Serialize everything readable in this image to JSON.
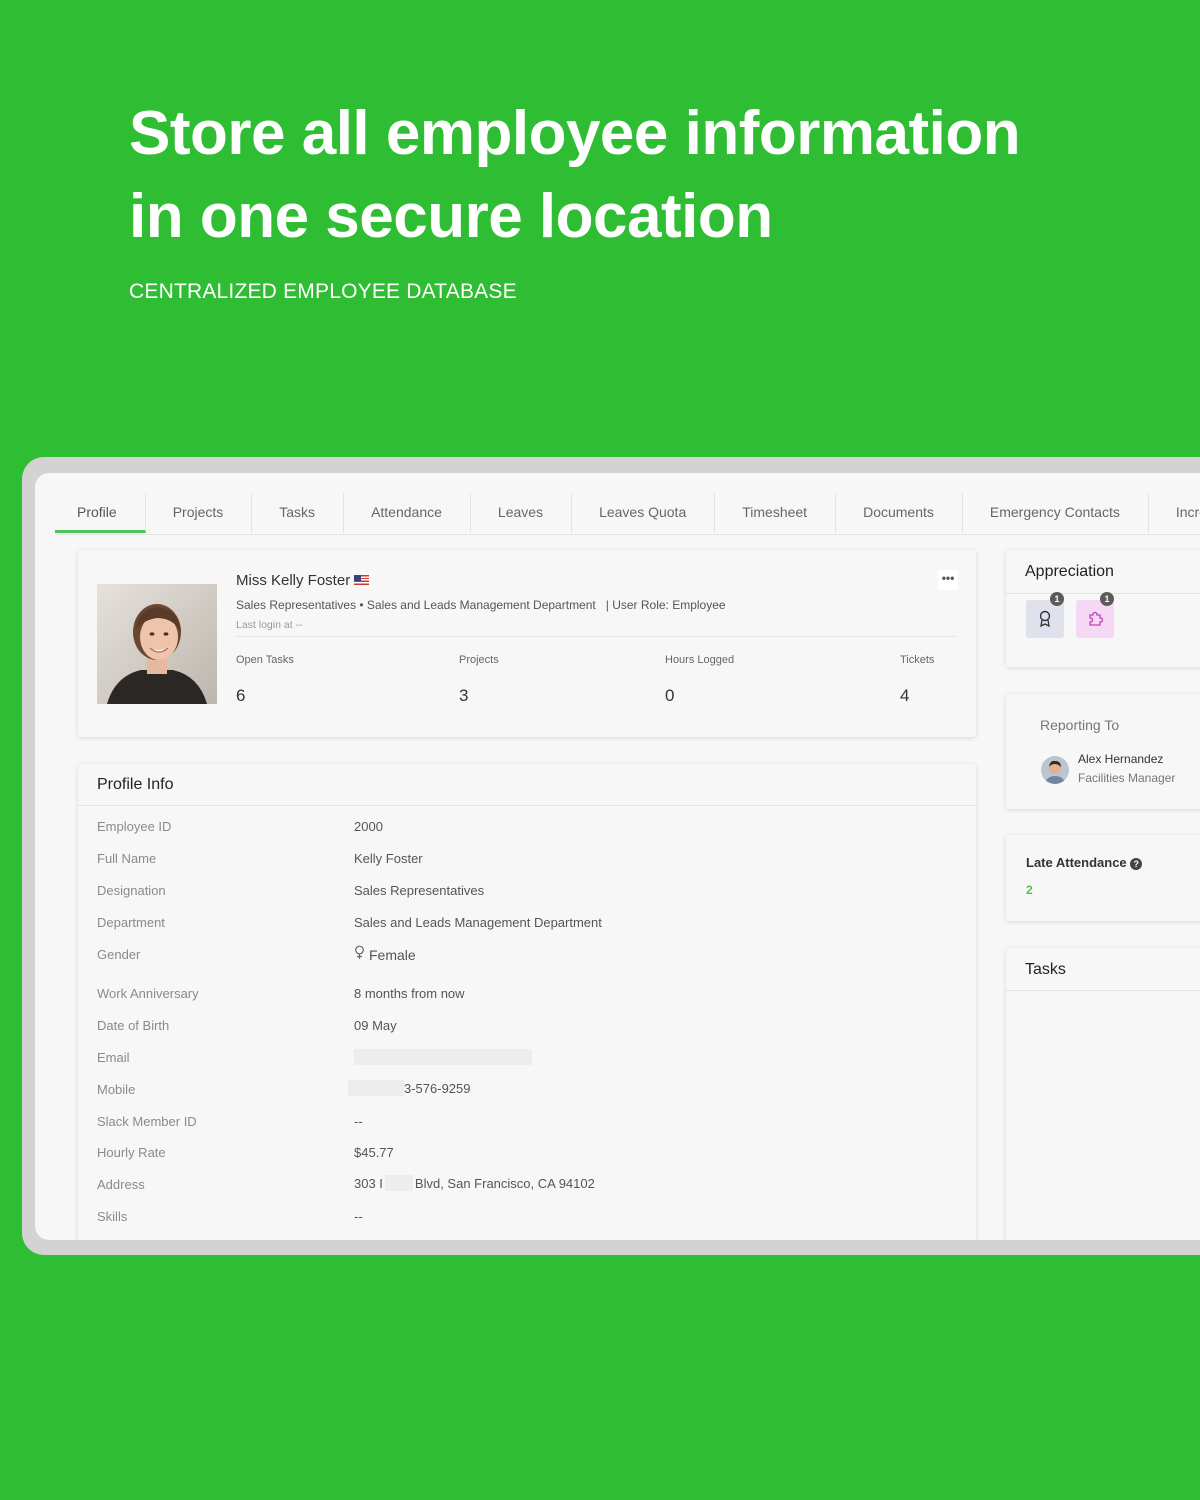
{
  "hero": {
    "title_line1": "Store all employee information",
    "title_line2": "in one secure location",
    "subtitle": "CENTRALIZED EMPLOYEE DATABASE"
  },
  "tabs": [
    "Profile",
    "Projects",
    "Tasks",
    "Attendance",
    "Leaves",
    "Leaves Quota",
    "Timesheet",
    "Documents",
    "Emergency Contacts",
    "Incre"
  ],
  "active_tab": "Profile",
  "profile": {
    "name": "Miss Kelly Foster",
    "meta": "Sales Representatives • Sales and Leads Management Department   | User Role: Employee",
    "last_login": "Last login at --",
    "more": "•••",
    "stats": [
      {
        "label": "Open Tasks",
        "value": "6"
      },
      {
        "label": "Projects",
        "value": "3"
      },
      {
        "label": "Hours Logged",
        "value": "0"
      },
      {
        "label": "Tickets",
        "value": "4"
      }
    ]
  },
  "profile_info": {
    "title": "Profile Info",
    "rows": [
      {
        "label": "Employee ID",
        "value": "2000"
      },
      {
        "label": "Full Name",
        "value": "Kelly Foster"
      },
      {
        "label": "Designation",
        "value": "Sales Representatives"
      },
      {
        "label": "Department",
        "value": "Sales and Leads Management Department"
      },
      {
        "label": "Gender",
        "value": "Female"
      },
      {
        "label": "Work Anniversary",
        "value": "8 months from now"
      },
      {
        "label": "Date of Birth",
        "value": "09 May"
      },
      {
        "label": "Email",
        "value": ""
      },
      {
        "label": "Mobile",
        "value": "3-576-9259"
      },
      {
        "label": "Slack Member ID",
        "value": "--"
      },
      {
        "label": "Hourly Rate",
        "value": "$45.77"
      },
      {
        "label": "Address",
        "value_prefix": "303 I",
        "value": "Blvd, San Francisco, CA 94102"
      },
      {
        "label": "Skills",
        "value": "--"
      }
    ],
    "gender_icon": "female-icon"
  },
  "appreciation": {
    "title": "Appreciation",
    "badges": [
      {
        "icon": "award-ribbon-icon",
        "count": "1",
        "color": "#dfe2ec"
      },
      {
        "icon": "puzzle-icon",
        "count": "1",
        "color": "#f5d8f3"
      }
    ]
  },
  "reporting": {
    "title": "Reporting To",
    "name": "Alex Hernandez",
    "role": "Facilities Manager"
  },
  "late_attendance": {
    "title": "Late Attendance",
    "value": "2",
    "value_color": "#4fc35a"
  },
  "tasks": {
    "title": "Tasks"
  }
}
